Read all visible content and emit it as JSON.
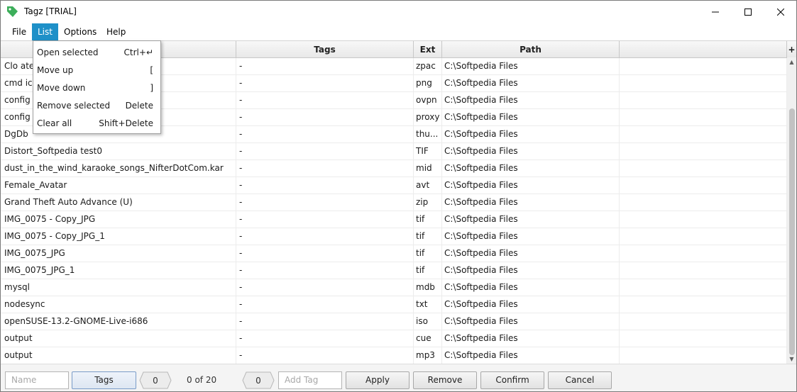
{
  "window": {
    "title": "Tagz [TRIAL]"
  },
  "titlebar": {
    "min_glyph": "—",
    "max_glyph": "□",
    "close_glyph": "✕"
  },
  "menubar": {
    "file": "File",
    "list": "List",
    "options": "Options",
    "help": "Help"
  },
  "list_menu": {
    "items": [
      {
        "label": "Open selected",
        "shortcut": "Ctrl+↵"
      },
      {
        "label": "Move up",
        "shortcut": "["
      },
      {
        "label": "Move down",
        "shortcut": "]"
      },
      {
        "label": "Remove selected",
        "shortcut": "Delete"
      },
      {
        "label": "Clear all",
        "shortcut": "Shift+Delete"
      }
    ]
  },
  "table": {
    "columns": {
      "name": "",
      "tags": "Tags",
      "ext": "Ext",
      "path": "Path",
      "add": "+"
    },
    "rows": [
      {
        "name": "Clo atel",
        "tags": "-",
        "ext": "zpac",
        "path": "C:\\Softpedia Files"
      },
      {
        "name": "cmd ic",
        "tags": "-",
        "ext": "png",
        "path": "C:\\Softpedia Files"
      },
      {
        "name": "config",
        "tags": "-",
        "ext": "ovpn",
        "path": "C:\\Softpedia Files"
      },
      {
        "name": "config",
        "tags": "-",
        "ext": "proxy",
        "path": "C:\\Softpedia Files"
      },
      {
        "name": "DgDb",
        "tags": "-",
        "ext": "thu...",
        "path": "C:\\Softpedia Files"
      },
      {
        "name": "Distort_Softpedia test0",
        "tags": "-",
        "ext": "TIF",
        "path": "C:\\Softpedia Files"
      },
      {
        "name": "dust_in_the_wind_karaoke_songs_NifterDotCom.kar",
        "tags": "-",
        "ext": "mid",
        "path": "C:\\Softpedia Files"
      },
      {
        "name": "Female_Avatar",
        "tags": "-",
        "ext": "avt",
        "path": "C:\\Softpedia Files"
      },
      {
        "name": "Grand Theft Auto Advance (U)",
        "tags": "-",
        "ext": "zip",
        "path": "C:\\Softpedia Files"
      },
      {
        "name": "IMG_0075 - Copy_JPG",
        "tags": "-",
        "ext": "tif",
        "path": "C:\\Softpedia Files"
      },
      {
        "name": "IMG_0075 - Copy_JPG_1",
        "tags": "-",
        "ext": "tif",
        "path": "C:\\Softpedia Files"
      },
      {
        "name": "IMG_0075_JPG",
        "tags": "-",
        "ext": "tif",
        "path": "C:\\Softpedia Files"
      },
      {
        "name": "IMG_0075_JPG_1",
        "tags": "-",
        "ext": "tif",
        "path": "C:\\Softpedia Files"
      },
      {
        "name": "mysql",
        "tags": "-",
        "ext": "mdb",
        "path": "C:\\Softpedia Files"
      },
      {
        "name": "nodesync",
        "tags": "-",
        "ext": "txt",
        "path": "C:\\Softpedia Files"
      },
      {
        "name": "openSUSE-13.2-GNOME-Live-i686",
        "tags": "-",
        "ext": "iso",
        "path": "C:\\Softpedia Files"
      },
      {
        "name": "output",
        "tags": "-",
        "ext": "cue",
        "path": "C:\\Softpedia Files"
      },
      {
        "name": "output",
        "tags": "-",
        "ext": "mp3",
        "path": "C:\\Softpedia Files"
      }
    ]
  },
  "bottombar": {
    "name_placeholder": "Name",
    "tags_button": "Tags",
    "tags_count": "0",
    "counter": "0 of 20",
    "selected_count": "0",
    "addtag_placeholder": "Add Tag",
    "apply_button": "Apply",
    "remove_button": "Remove",
    "confirm_button": "Confirm",
    "cancel_button": "Cancel"
  },
  "colors": {
    "accent": "#1e90c8",
    "app_icon": "#3cae5a"
  }
}
